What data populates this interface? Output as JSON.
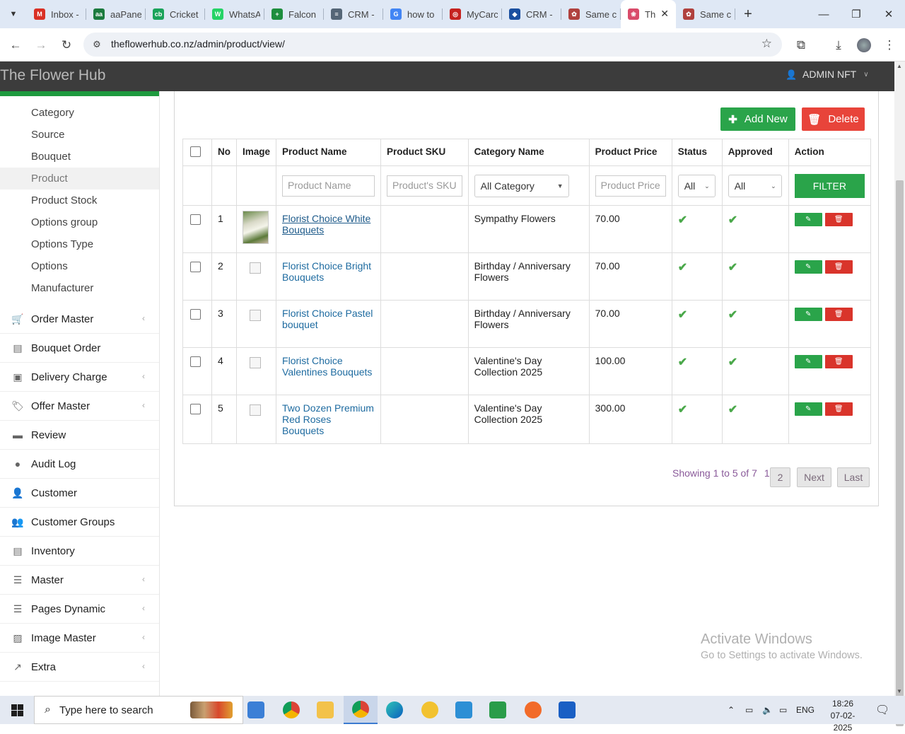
{
  "browser": {
    "tabs": [
      {
        "title": "Inbox -",
        "color": "#d93025",
        "glyph": "M"
      },
      {
        "title": "aaPane",
        "color": "#1b7a3e",
        "glyph": "aa"
      },
      {
        "title": "Cricket",
        "color": "#1aa35b",
        "glyph": "cb"
      },
      {
        "title": "WhatsA",
        "color": "#25d366",
        "glyph": "W"
      },
      {
        "title": "Falcon",
        "color": "#1e8e3e",
        "glyph": "+"
      },
      {
        "title": "CRM -",
        "color": "#556677",
        "glyph": "≡"
      },
      {
        "title": "how to",
        "color": "#4285f4",
        "glyph": "G"
      },
      {
        "title": "MyCarc",
        "color": "#c5221f",
        "glyph": "◎"
      },
      {
        "title": "CRM -",
        "color": "#1a4fa0",
        "glyph": "◆"
      },
      {
        "title": "Same c",
        "color": "#b0413e",
        "glyph": "✿"
      }
    ],
    "active_tab": {
      "title": "Th",
      "color": "#d94b6a",
      "glyph": "❀"
    },
    "tab_after": {
      "title": "Same c",
      "color": "#b0413e",
      "glyph": "✿"
    },
    "url": "theflowerhub.co.nz/admin/product/view/"
  },
  "header": {
    "brand": "The Flower Hub",
    "user": "ADMIN NFT"
  },
  "sidebar": {
    "subitems": [
      "Category",
      "Source",
      "Bouquet",
      "Product",
      "Product Stock",
      "Options group",
      "Options Type",
      "Options",
      "Manufacturer"
    ],
    "active_subitem": "Product",
    "menu": [
      {
        "label": "Order Master",
        "icon": "🛒",
        "chevron": true
      },
      {
        "label": "Bouquet Order",
        "icon": "▤",
        "chevron": false
      },
      {
        "label": "Delivery Charge",
        "icon": "▣",
        "chevron": true
      },
      {
        "label": "Offer Master",
        "icon": "🏷",
        "chevron": true
      },
      {
        "label": "Review",
        "icon": "▬",
        "chevron": false
      },
      {
        "label": "Audit Log",
        "icon": "●",
        "chevron": false
      },
      {
        "label": "Customer",
        "icon": "👤",
        "chevron": false
      },
      {
        "label": "Customer Groups",
        "icon": "👥",
        "chevron": false
      },
      {
        "label": "Inventory",
        "icon": "▤",
        "chevron": false
      },
      {
        "label": "Master",
        "icon": "☰",
        "chevron": true
      },
      {
        "label": "Pages Dynamic",
        "icon": "☰",
        "chevron": true
      },
      {
        "label": "Image Master",
        "icon": "▨",
        "chevron": true
      },
      {
        "label": "Extra",
        "icon": "↗",
        "chevron": true
      }
    ]
  },
  "toolbar": {
    "add_label": "Add New",
    "delete_label": "Delete"
  },
  "table": {
    "headers": [
      "",
      "No",
      "Image",
      "Product Name",
      "Product SKU",
      "Category Name",
      "Product Price",
      "Status",
      "Approved",
      "Action"
    ],
    "filters": {
      "name_placeholder": "Product Name",
      "sku_placeholder": "Product's SKU",
      "category": "All Category",
      "price_placeholder": "Product Price",
      "status": "All",
      "approved": "All",
      "filter_label": "FILTER"
    },
    "rows": [
      {
        "no": "1",
        "name": "Florist Choice White Bouquets",
        "sku": "",
        "category": "Sympathy Flowers",
        "price": "70.00",
        "has_image": true
      },
      {
        "no": "2",
        "name": "Florist Choice Bright Bouquets",
        "sku": "",
        "category": "Birthday / Anniversary Flowers",
        "price": "70.00",
        "has_image": false
      },
      {
        "no": "3",
        "name": "Florist Choice Pastel bouquet",
        "sku": "",
        "category": "Birthday / Anniversary Flowers",
        "price": "70.00",
        "has_image": false
      },
      {
        "no": "4",
        "name": "Florist Choice Valentines Bouquets",
        "sku": "",
        "category": "Valentine's Day Collection 2025",
        "price": "100.00",
        "has_image": false
      },
      {
        "no": "5",
        "name": "Two Dozen Premium Red Roses Bouquets",
        "sku": "",
        "category": "Valentine's Day Collection 2025",
        "price": "300.00",
        "has_image": false
      }
    ]
  },
  "pagination": {
    "info": "Showing 1 to 5 of 7",
    "current": "1",
    "page2": "2",
    "next": "Next",
    "last": "Last"
  },
  "watermark": {
    "line1": "Activate Windows",
    "line2": "Go to Settings to activate Windows."
  },
  "taskbar": {
    "search_placeholder": "Type here to search",
    "language": "ENG",
    "time": "18:26",
    "date": "07-02-2025"
  }
}
